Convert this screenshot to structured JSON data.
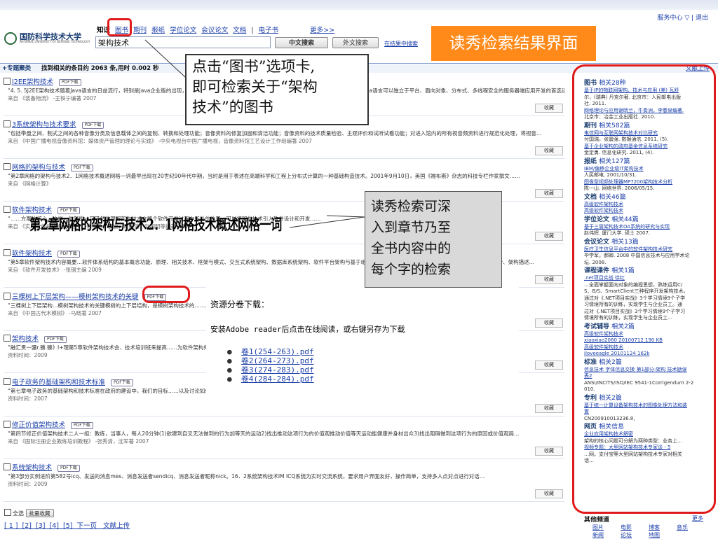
{
  "top_links": "服务中心 ▽ | 退出",
  "logo": {
    "name_cn": "国防科学技术大学",
    "name_en": "NATIONAL UNIVERSITY OF DEFENSE TECHNOLOGY"
  },
  "tabs": [
    "知识",
    "图书",
    "期刊",
    "报纸",
    "学位论文",
    "会议论文",
    "文档",
    "|",
    "电子书",
    "更多>>"
  ],
  "search": {
    "value": "架构技术",
    "btn_search": "中文搜索",
    "btn_foreign": "外文搜索",
    "in_results": "在结果中搜索"
  },
  "title_banner": "读秀检索结果界面",
  "infobar": {
    "left": "+专题聚类",
    "found": "找到相关的条目约 2063 条,用时 0.002 秒",
    "right": "文献上传"
  },
  "callout1": [
    "点击“图书”选项卡,",
    "即可检索关于“架构",
    "技术”的图书"
  ],
  "callout2": [
    "读秀检索可深",
    "入到章节乃至",
    "全书内容中的",
    "每个字的检索"
  ],
  "pdf_label": "PDF下载",
  "collect_label": "收藏",
  "results": [
    {
      "title": "J2EE架构技术",
      "snip": "“4. 5. 5J2EE架构技术随着Java语言的日益流行，特别是Java企业版的出现，使得Java语言不仅仅局限在桌面应用程序的开发，其与平台无关的特性使得Java语言可以独立于平台、面向对象、分布式、多线程安全的服务器端应用开发的首选语言，从而以EJB为核心的J2EE技术……",
      "src": "来自 《装备物流》 -王铁宁编著 2007"
    },
    {
      "title": "3系统架构与技术要求",
      "snip": "“包括带盘之间、制式之间的各种音像分类及信息载体之间的复制、转换和处理功能；音像资料的修复加固和清洁功能；音像资料的技术质量检验、主观评价和试听试看功能；对进入馆内的所有视音频资料进行规范化处理，将视音…",
      "src": "来自 《中国广播电视音像资料馆：媒体资产管理的理论与实践》 -中央电视台中国广播电视，音像资料馆工艺设计工作组编著 2007"
    },
    {
      "title": "网格的架构与技术",
      "snip": "“第2章网格的架构与技术2．1网格技术概述网格一词最早出现在20世纪90年代中期，当时是用于表述在高端科学和工程上分布式计算的一种基础构造技术。2001年9月10日，美国《福布斯》杂志的科技专栏作家撰文……",
      "src": "来自 《网格计算》"
    },
    {
      "title": "软件架构技术",
      "snip": "“……方案的核心。这样，你就能一目了然地理解架构技术在整个软件开发过程中所处的位置，可以将架构技术引入软件设计和开发……",
      "src": "来自 《实用软件设计模式教程》 -徐宏哲，侯迪，赖国伟，赵明明等编著 2009"
    },
    {
      "title": "软件架构技术",
      "snip": "“第5章软件架构技术内容概要…软件体系结构的基本概念功能、原理、相关技术、框架与模式、交互式系统架构、数据库系统架构、软件平台架构与基于组件的软件架构技术，基于软件架构的研究与发展分析、设计、架构描述…",
      "src": "来自 《软件开发技术》 -张钢主编 2009"
    },
    {
      "title": "三棵树上下层架构——模树架构技术的关键",
      "snip": "“三棵树上下层架构…模树架构技术的关键模树的上下层结构，是模树架构技术的……，这样的形式由来已久，早期的商业模……",
      "src": "来自 《中国古代木模树》 -马晓著 2007"
    },
    {
      "title": "架构技术",
      "snip": "“融汇贯一疆r.骥.骥》I+理第5章软件架构技术会、技术培训班来提高……为软件架构师的工…",
      "src": "资料时间：2009"
    },
    {
      "title": "电子政务的基础架构和技术标准",
      "snip": "“第七章电子政务的基础架构和技术标准在政府的建设中，我们的目标……以及讨论如何与多个解决方案的供应商…",
      "src": "资料时间：2007"
    },
    {
      "title": "修正价值架构技术",
      "snip": "“第四节修正价值架构技术二人一组：教练，当事人，每人20分钟(1)欲建到自叉无法做到的行为加等天的运动2)找出推动这项行为的价值观推动价值等天运动能健康并身材出众3)找出阻碍做到这项行为的原因或价值观局…",
      "src": "来自 《国际注册企业教练培训教程》 -张秀清，沈军著 2007"
    },
    {
      "title": "系统架构技术",
      "snip": "“第3部分实例进阶第582号icq、发送的消息mes、消息发送者sendicq、消息发送者昵称nick。16．2系统架构技术IM ICQ系统为实时交流系统，要求用户界面友好，操作简单，支持多人点对点进行对话…",
      "src": "资料时间：2009"
    }
  ],
  "big_text": "第2章网格的架构与技术2．1网格技术概述网格一词",
  "popup": {
    "heading": "资源分卷下载：",
    "instruction": "安装Adobe reader后点击在线阅读，或右键另存为下载",
    "files": [
      "卷1(254-263).pdf",
      "卷2(264-273).pdf",
      "卷3(274-283).pdf",
      "卷4(284-284).pdf"
    ]
  },
  "bottom": {
    "select_all": "全选",
    "batch": "批量收藏",
    "pager": "[ 1 ]  [2]  [3]  [4]  [5]  下一页   文献上传"
  },
  "sidebar": [
    {
      "h": "图书",
      "c": "相关28种",
      "items": [
        [
          "l",
          "基于IP的物联网架构、技术与应用 (美) 瓦舒"
        ],
        [
          "m",
          "尔，(瑞典) 丹克尔著. 北京市：人民邮电出版"
        ],
        [
          "m",
          "社. 2011."
        ],
        [
          "l",
          "网格理论与应用谢晓兰，牛奏洲，李春泉编著."
        ],
        [
          "m",
          "北京市：冶金工业出版社. 2010."
        ]
      ]
    },
    {
      "h": "期刊",
      "c": "相关582篇",
      "items": [
        [
          "l",
          "电信网与互联网架构技术对比研究"
        ],
        [
          "m",
          "付国瑞，张震强. 数据通信. 2011, (5)."
        ],
        [
          "l",
          "基于企业架构的政府基金信息系统研究"
        ],
        [
          "m",
          "金定勇. 信息化研究. 2011, (4)."
        ]
      ]
    },
    {
      "h": "报纸",
      "c": "相关127篇",
      "items": [
        [
          "l",
          "IBM/偏移企业级IT架构技术"
        ],
        [
          "m",
          "人民邮电. 2001/10/31."
        ],
        [
          "l",
          "图像型视频处理器MP7200架构技术分析"
        ],
        [
          "m",
          "陈一山. 网络世界. 2006/05/15."
        ]
      ]
    },
    {
      "h": "文档",
      "c": "相关46篇",
      "items": [
        [
          "l",
          "高级软件架构技术"
        ],
        [
          "l",
          "高级软件架构技术"
        ]
      ]
    },
    {
      "h": "学位论文",
      "c": "相关44篇",
      "items": [
        [
          "l",
          "基于三层架构技术OA系统的研究与实现"
        ],
        [
          "m",
          "赵伟辉. 厦门大学. 硕士 2007."
        ]
      ]
    },
    {
      "h": "会议论文",
      "c": "相关13篇",
      "items": [
        [
          "l",
          "医疗卫生信息平台中的软件架构技术研究"
        ],
        [
          "m",
          "毕学军，郝卿. 2008 中国信息技术与应用学术论"
        ],
        [
          "m",
          "坛. 2008."
        ]
      ]
    },
    {
      "h": "课程课件",
      "c": "相关1篇",
      "items": [
        [
          "l",
          ".net项目实战 徐红"
        ],
        [
          "m",
          "…全面掌握面向对象的编程思想，熟练运用C/"
        ],
        [
          "m",
          "S、B/S、SmartClient三种程序开发架构技术。"
        ],
        [
          "m",
          "通过对《.NET项目实战》3个学习情境9个子学"
        ],
        [
          "m",
          "习情境所有的训练，实现学生与企业员工。通"
        ],
        [
          "m",
          "过对《.NET项目实战》3个学习情境9个子学习"
        ],
        [
          "m",
          "情境所有的训练，实现学生与企业员工…"
        ]
      ]
    },
    {
      "h": "考试辅导",
      "c": "相关2篇",
      "items": [
        [
          "l",
          "高级软件架构技术"
        ],
        [
          "l",
          "xiaoxiao2060 20100712 190 KB"
        ],
        [
          "l",
          "高级软件架构技术"
        ],
        [
          "l",
          "iloveeagle 20101124 162k"
        ]
      ]
    },
    {
      "h": "标准",
      "c": "相关2篇",
      "items": [
        [
          "l",
          "信息技术 字体信息交换 第1部分:架构 技术勘误"
        ],
        [
          "l",
          "表2"
        ],
        [
          "m",
          "ANSI/INCITS/ISO/IEC 9541-1Corrigendum 2-2"
        ],
        [
          "m",
          "010."
        ]
      ]
    },
    {
      "h": "专利",
      "c": "相关2篇",
      "items": [
        [
          "l",
          "基于统一计算设备架构技术的图像处理方法和装"
        ],
        [
          "l",
          "置"
        ],
        [
          "m",
          "CN200910013236.8,"
        ]
      ]
    },
    {
      "h": "网页",
      "c": "相关信息",
      "items": [
        [
          "l",
          "企业应用架构技术解密"
        ],
        [
          "m",
          "架构的核心问题可分解为两种类型：业务上…"
        ],
        [
          "l",
          "视频专题：大型网站架构技术专家谈 - 5"
        ],
        [
          "m",
          "…网。支付宝等大型网站架构技术专家对相关"
        ],
        [
          "m",
          "话…"
        ]
      ]
    }
  ],
  "other_channels": {
    "title": "其他频道",
    "more": "更多",
    "items": [
      "图片",
      "电影",
      "博客",
      "音乐",
      "新闻",
      "论坛",
      "地图"
    ]
  }
}
